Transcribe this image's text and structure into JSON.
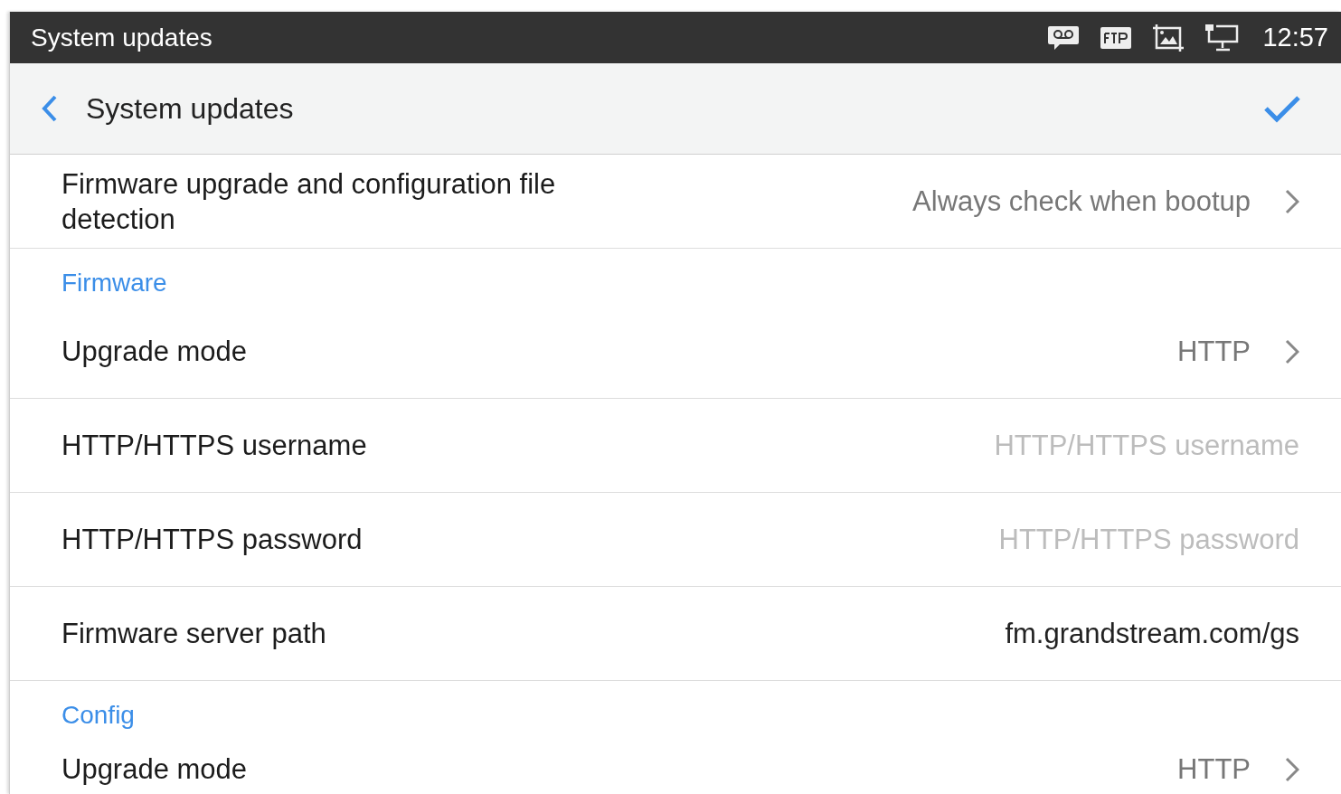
{
  "status_bar": {
    "title": "System updates",
    "time": "12:57"
  },
  "header": {
    "title": "System updates"
  },
  "items": [
    {
      "kind": "select",
      "label": "Firmware upgrade and configuration file detection",
      "value": "Always check when bootup"
    },
    {
      "kind": "section",
      "label": "Firmware"
    },
    {
      "kind": "select",
      "label": "Upgrade mode",
      "value": "HTTP"
    },
    {
      "kind": "input",
      "label": "HTTP/HTTPS username",
      "placeholder": "HTTP/HTTPS username"
    },
    {
      "kind": "input",
      "label": "HTTP/HTTPS password",
      "placeholder": "HTTP/HTTPS password"
    },
    {
      "kind": "input",
      "label": "Firmware server path",
      "value": "fm.grandstream.com/gs"
    },
    {
      "kind": "section",
      "label": "Config"
    },
    {
      "kind": "select",
      "label": "Upgrade mode",
      "value": "HTTP"
    }
  ]
}
